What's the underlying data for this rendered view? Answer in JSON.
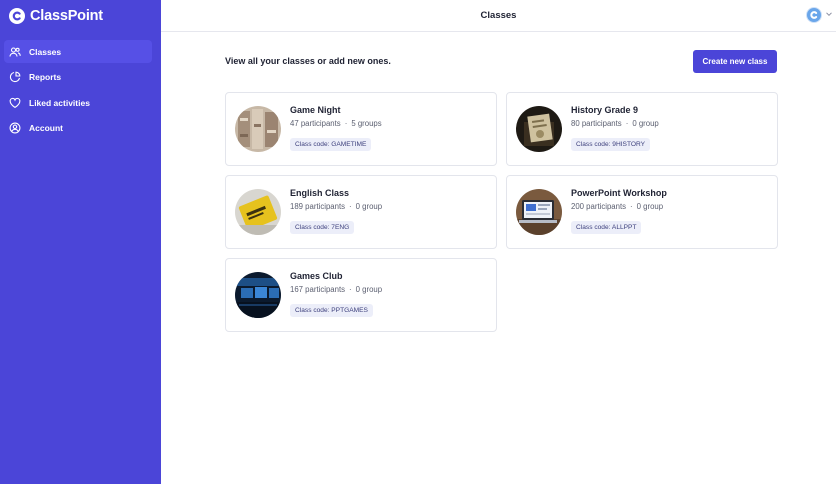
{
  "brand": {
    "name": "ClassPoint"
  },
  "sidebar": {
    "items": [
      {
        "label": "Classes",
        "icon": "users-icon",
        "active": true
      },
      {
        "label": "Reports",
        "icon": "pie-chart-icon",
        "active": false
      },
      {
        "label": "Liked activities",
        "icon": "heart-icon",
        "active": false
      },
      {
        "label": "Account",
        "icon": "user-circle-icon",
        "active": false
      }
    ]
  },
  "header": {
    "title": "Classes"
  },
  "main": {
    "headline": "View all your classes or add new ones.",
    "create_label": "Create new class"
  },
  "classes": [
    {
      "name": "Game Night",
      "participants": "47 participants",
      "groups": "5 groups",
      "code": "Class code: GAMETIME"
    },
    {
      "name": "History Grade 9",
      "participants": "80 participants",
      "groups": "0 group",
      "code": "Class code: 9HISTORY"
    },
    {
      "name": "English Class",
      "participants": "189 participants",
      "groups": "0 group",
      "code": "Class code: 7ENG"
    },
    {
      "name": "PowerPoint Workshop",
      "participants": "200 participants",
      "groups": "0 group",
      "code": "Class code: ALLPPT"
    },
    {
      "name": "Games Club",
      "participants": "167 participants",
      "groups": "0 group",
      "code": "Class code: PPTGAMES"
    }
  ],
  "meta_separator": "·",
  "colors": {
    "accent": "#4b45d8",
    "badge_bg": "#eceef9"
  }
}
